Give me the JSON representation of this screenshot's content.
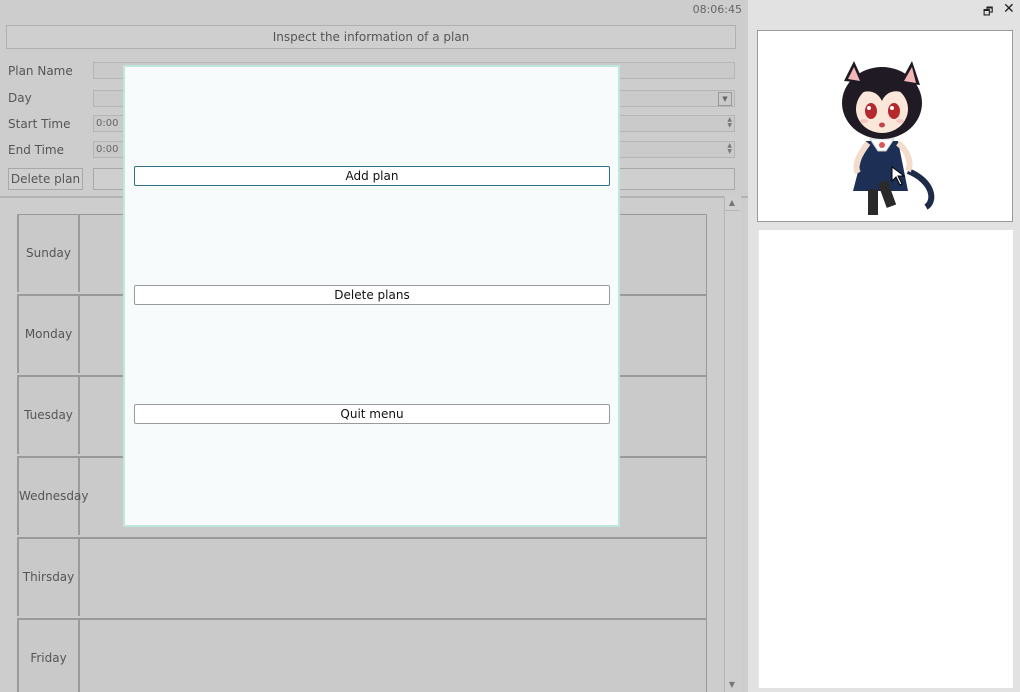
{
  "clock": "08:06:45",
  "title_bar": "Inspect the information of a plan",
  "form": {
    "plan_name_label": "Plan Name",
    "day_label": "Day",
    "start_time_label": "Start Time",
    "start_time_value": "0:00",
    "end_time_label": "End Time",
    "end_time_value": "0:00",
    "delete_plan_label": "Delete plan"
  },
  "days": [
    "Sunday",
    "Monday",
    "Tuesday",
    "Wednesday",
    "Thirsday",
    "Friday"
  ],
  "menu": {
    "add_plan": "Add plan",
    "delete_plans": "Delete plans",
    "quit_menu": "Quit menu"
  },
  "side_panel": {
    "icons": [
      "restore-window-icon",
      "close-icon",
      "cat-girl-character-icon"
    ]
  },
  "colors": {
    "menu_background": "#f7fbfb",
    "menu_border": "#bfe8dc",
    "focus_border": "#2f6f86"
  }
}
